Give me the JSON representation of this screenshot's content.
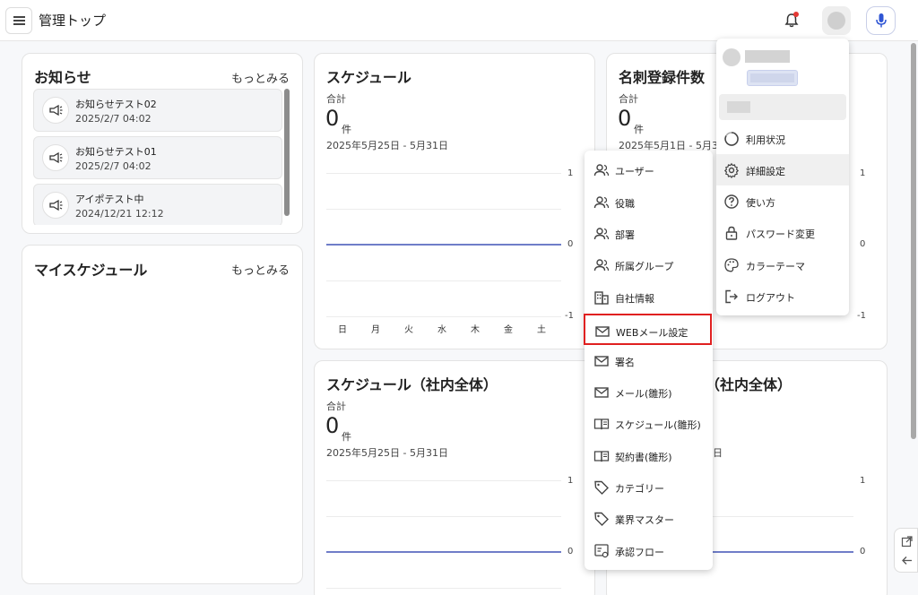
{
  "header": {
    "title": "管理トップ"
  },
  "news": {
    "title": "お知らせ",
    "more": "もっとみる",
    "items": [
      {
        "title": "お知らせテスト02",
        "date": "2025/2/7 04:02"
      },
      {
        "title": "お知らせテスト01",
        "date": "2025/2/7 04:02"
      },
      {
        "title": "アイポテスト中",
        "date": "2024/12/21 12:12"
      }
    ]
  },
  "my_schedule": {
    "title": "マイスケジュール",
    "more": "もっとみる"
  },
  "schedule": {
    "title": "スケジュール",
    "total_label": "合計",
    "total_value": "0",
    "unit": "件",
    "range": "2025年5月25日 - 5月31日",
    "y_ticks": [
      "1",
      "0",
      "-1"
    ],
    "days": [
      "日",
      "月",
      "火",
      "水",
      "木",
      "金",
      "土"
    ]
  },
  "cards_registered": {
    "title": "名刺登録件数",
    "total_label": "合計",
    "total_value": "0",
    "unit": "件",
    "range": "2025年5月1日 - 5月31日",
    "y_ticks": [
      "1",
      "0",
      "-1"
    ]
  },
  "schedule_company": {
    "title": "スケジュール（社内全体）",
    "total_label": "合計",
    "total_value": "0",
    "unit": "件",
    "range": "2025年5月25日 - 5月31日",
    "y_ticks": [
      "1",
      "0"
    ]
  },
  "right_lower": {
    "title_visible": "（社内全体）",
    "range_visible": "日",
    "y_ticks": [
      "1",
      "0"
    ]
  },
  "settings_menu": {
    "items": [
      {
        "label": "ユーザー",
        "icon": "users-icon"
      },
      {
        "label": "役職",
        "icon": "users-icon"
      },
      {
        "label": "部署",
        "icon": "users-icon"
      },
      {
        "label": "所属グループ",
        "icon": "users-icon"
      },
      {
        "label": "自社情報",
        "icon": "building-icon"
      },
      {
        "label": "WEBメール設定",
        "icon": "mail-icon"
      },
      {
        "label": "署名",
        "icon": "mail-icon"
      },
      {
        "label": "メール(雛形)",
        "icon": "mail-icon"
      },
      {
        "label": "スケジュール(雛形)",
        "icon": "book-icon"
      },
      {
        "label": "契約書(雛形)",
        "icon": "book-icon"
      },
      {
        "label": "カテゴリー",
        "icon": "tag-icon"
      },
      {
        "label": "業界マスター",
        "icon": "tag-icon"
      },
      {
        "label": "承認フロー",
        "icon": "flow-icon"
      }
    ]
  },
  "user_menu": {
    "items": [
      {
        "label": "利用状況",
        "icon": "usage-icon"
      },
      {
        "label": "詳細設定",
        "icon": "gear-icon"
      },
      {
        "label": "使い方",
        "icon": "help-icon"
      },
      {
        "label": "パスワード変更",
        "icon": "lock-icon"
      },
      {
        "label": "カラーテーマ",
        "icon": "palette-icon"
      },
      {
        "label": "ログアウト",
        "icon": "logout-icon"
      }
    ]
  },
  "colors": {
    "accent": "#3f51b5",
    "highlight_border": "#e02020",
    "notification_dot": "#e53935"
  }
}
